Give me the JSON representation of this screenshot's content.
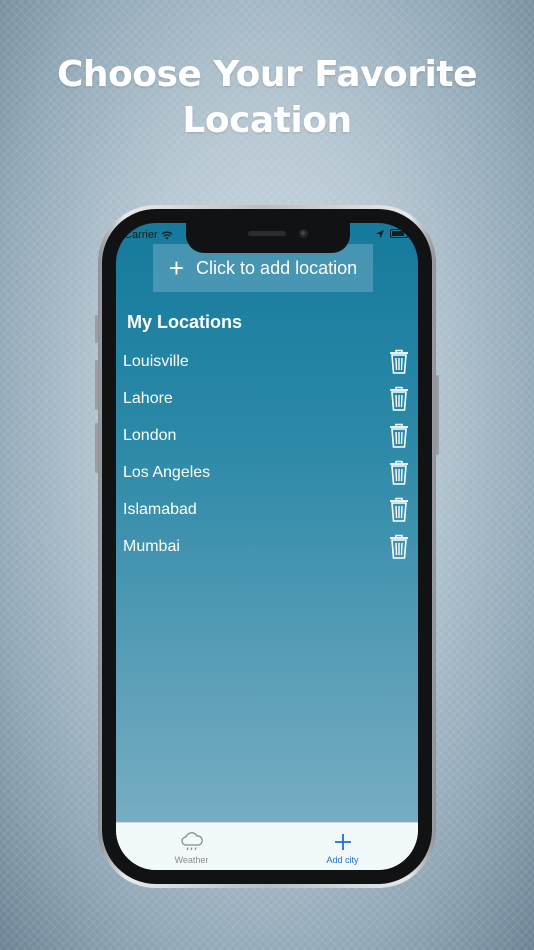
{
  "headline": {
    "line1": "Choose Your Favorite",
    "line2": "Location"
  },
  "status_bar": {
    "carrier": "Carrier"
  },
  "add_location": {
    "plus": "+",
    "label": "Click to add location"
  },
  "section_title": "My Locations",
  "locations": [
    {
      "name": "Louisville"
    },
    {
      "name": "Lahore"
    },
    {
      "name": "London"
    },
    {
      "name": "Los Angeles"
    },
    {
      "name": "Islamabad"
    },
    {
      "name": "Mumbai"
    }
  ],
  "tabbar": {
    "weather_label": "Weather",
    "add_city_label": "Add city"
  },
  "colors": {
    "accent": "#1f6fd6",
    "list_text": "#ffffff"
  }
}
